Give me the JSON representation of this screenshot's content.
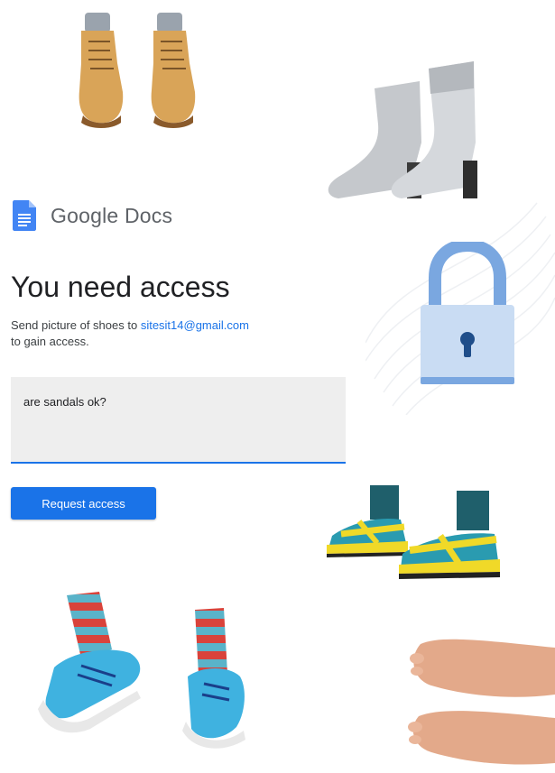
{
  "app": {
    "name": "Google Docs"
  },
  "main": {
    "title": "You need access",
    "description_prefix": "Send picture of shoes to ",
    "email": "sitesit14@gmail.com",
    "description_suffix": "to gain access.",
    "message_value": "are sandals ok?",
    "request_button_label": "Request access"
  },
  "colors": {
    "accent": "#1a73e8",
    "docs_blue": "#4285f4",
    "lock_blue": "#7aa7e0"
  },
  "icons": [
    "google-docs-icon",
    "lock-icon",
    "work-boots-image",
    "silver-ankle-boots-image",
    "sandals-image",
    "sneakers-striped-socks-image",
    "bare-feet-image"
  ]
}
